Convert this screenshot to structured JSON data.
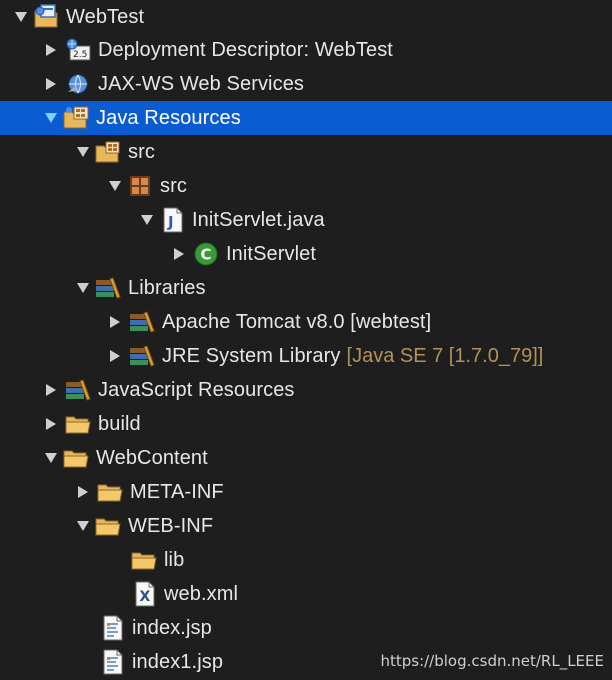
{
  "explorer": {
    "items": [
      {
        "label": "WebTest",
        "icon": "web-project-icon",
        "expanded": true
      },
      {
        "label": "Deployment Descriptor: WebTest",
        "icon": "deployment-descriptor-icon",
        "expanded": false
      },
      {
        "label": "JAX-WS Web Services",
        "icon": "web-services-icon",
        "expanded": false
      },
      {
        "label": "Java Resources",
        "icon": "java-resources-icon",
        "expanded": true,
        "selected": true
      },
      {
        "label": "src",
        "icon": "source-folder-icon",
        "expanded": true
      },
      {
        "label": "src",
        "icon": "package-icon",
        "expanded": true
      },
      {
        "label": "InitServlet.java",
        "icon": "java-file-icon",
        "expanded": true
      },
      {
        "label": "InitServlet",
        "icon": "class-icon",
        "expanded": false
      },
      {
        "label": "Libraries",
        "icon": "library-icon",
        "expanded": true
      },
      {
        "label": "Apache Tomcat v8.0 [webtest]",
        "icon": "library-icon",
        "expanded": false
      },
      {
        "label": "JRE System Library",
        "decoration": "[Java SE 7 [1.7.0_79]]",
        "icon": "library-icon",
        "expanded": false
      },
      {
        "label": "JavaScript Resources",
        "icon": "library-icon",
        "expanded": false
      },
      {
        "label": "build",
        "icon": "folder-icon",
        "expanded": false
      },
      {
        "label": "WebContent",
        "icon": "folder-icon",
        "expanded": true
      },
      {
        "label": "META-INF",
        "icon": "folder-icon",
        "expanded": false
      },
      {
        "label": "WEB-INF",
        "icon": "folder-icon",
        "expanded": true
      },
      {
        "label": "lib",
        "icon": "folder-icon"
      },
      {
        "label": "web.xml",
        "icon": "xml-file-icon"
      },
      {
        "label": "index.jsp",
        "icon": "jsp-file-icon"
      },
      {
        "label": "index1.jsp",
        "icon": "jsp-file-icon"
      }
    ]
  },
  "colors": {
    "background": "#1e1e1e",
    "selection": "#0b5bd3",
    "text": "#e7e7e7",
    "decoration": "#b0925a",
    "folder": "#e9b65a",
    "class_green": "#3a9a3a"
  },
  "watermark": "https://blog.csdn.net/RL_LEEE"
}
